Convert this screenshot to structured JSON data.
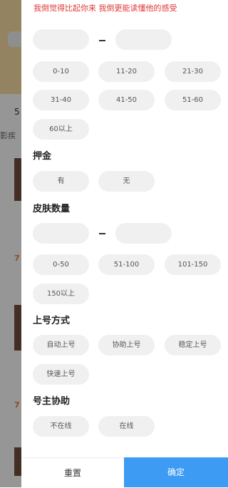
{
  "background": {
    "text_a": "5",
    "text_b": "影疾",
    "price_a": "7",
    "price_b": "7"
  },
  "marquee": "我倒觉得比起你来 我倒更能读懂他的感受",
  "price_range": {
    "min_placeholder": "",
    "max_placeholder": "",
    "options": [
      "0-10",
      "11-20",
      "21-30",
      "31-40",
      "41-50",
      "51-60",
      "60以上"
    ]
  },
  "deposit": {
    "title": "押金",
    "options": [
      "有",
      "无"
    ]
  },
  "skin_count": {
    "title": "皮肤数量",
    "min_placeholder": "",
    "max_placeholder": "",
    "options": [
      "0-50",
      "51-100",
      "101-150",
      "150以上"
    ]
  },
  "login_method": {
    "title": "上号方式",
    "options": [
      "自动上号",
      "协助上号",
      "稳定上号",
      "快速上号"
    ]
  },
  "owner_assist": {
    "title": "号主协助",
    "options": [
      "不在线",
      "在线"
    ]
  },
  "footer": {
    "reset": "重置",
    "confirm": "确定"
  },
  "colors": {
    "accent": "#3d9bf4",
    "marquee": "#e03a3a",
    "pill_bg": "#f0f0f0"
  }
}
